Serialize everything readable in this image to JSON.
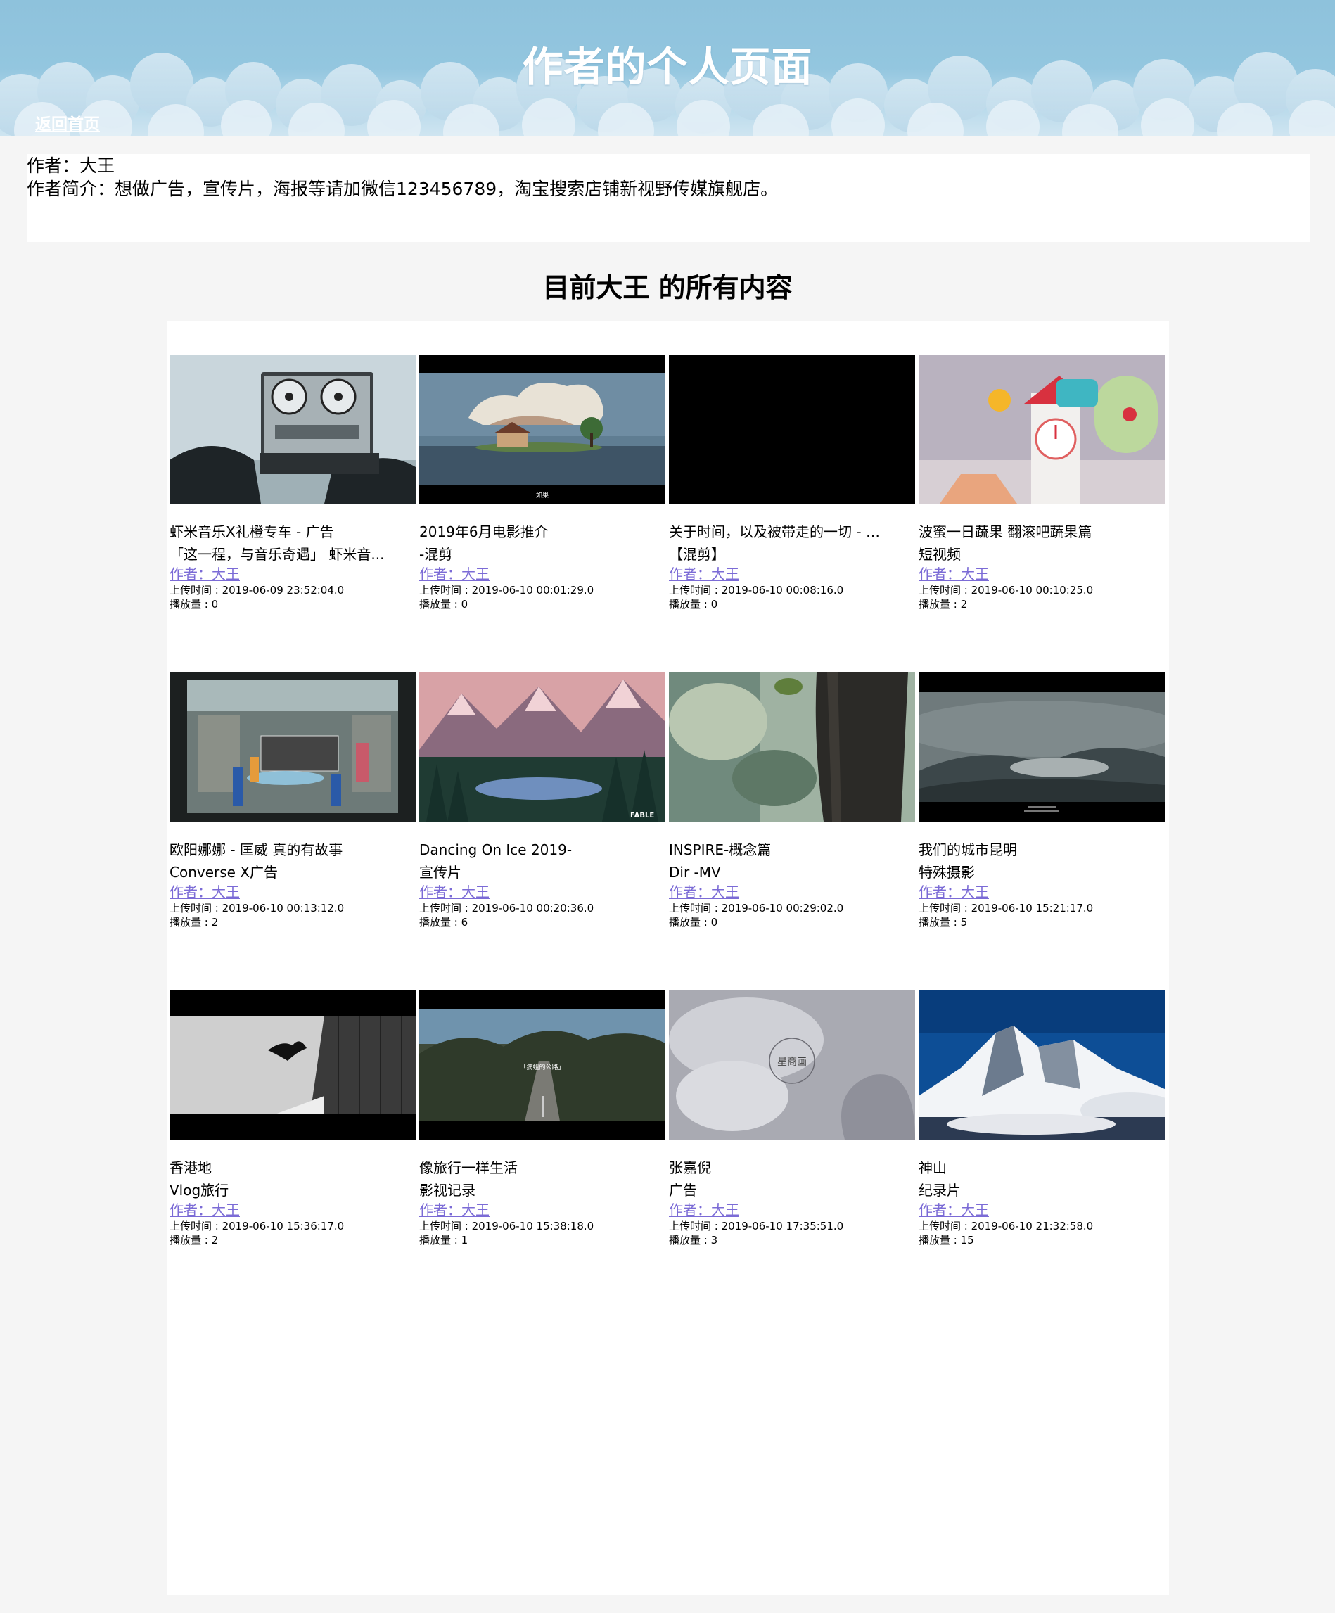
{
  "header": {
    "title": "作者的个人页面",
    "home_link": "返回首页"
  },
  "author": {
    "name_line": "作者：大王",
    "intro_line": "作者简介：想做广告，宣传片，海报等请加微信123456789，淘宝搜索店铺新视野传媒旗舰店。"
  },
  "section_title": "目前大王 的所有内容",
  "videos": [
    {
      "title1": "虾米音乐X礼橙专车 - 广告",
      "title2": "「这一程，与音乐奇遇」 虾米音...",
      "author": "作者：大王",
      "upload": "上传时间 : 2019-06-09 23:52:04.0",
      "plays": "播放量 : 0",
      "thumb": "tape-recorder"
    },
    {
      "title1": "2019年6月电影推介",
      "title2": "-混剪",
      "author": "作者：大王",
      "upload": "上传时间 : 2019-06-10 00:01:29.0",
      "plays": "播放量 : 0",
      "thumb": "anime-house",
      "caption": "如果"
    },
    {
      "title1": "关于时间，以及被带走的一切 - 混剪",
      "title2": "【混剪】",
      "author": "作者：大王",
      "upload": "上传时间 : 2019-06-10 00:08:16.0",
      "plays": "播放量 : 0",
      "thumb": "black-frame"
    },
    {
      "title1": "波蜜一日蔬果 翻滚吧蔬果篇",
      "title2": "短视频",
      "author": "作者：大王",
      "upload": "上传时间 : 2019-06-10 00:10:25.0",
      "plays": "播放量 : 2",
      "thumb": "clock-house"
    },
    {
      "title1": "欧阳娜娜 - 匡威 真的有故事",
      "title2": "Converse X广告",
      "author": "作者：大王",
      "upload": "上传时间 : 2019-06-10 00:13:12.0",
      "plays": "播放量 : 2",
      "thumb": "store-interior"
    },
    {
      "title1": "Dancing On Ice 2019-",
      "title2": "宣传片",
      "author": "作者：大王",
      "upload": "上传时间 : 2019-06-10 00:20:36.0",
      "plays": "播放量 : 6",
      "thumb": "snow-mountains",
      "caption": "FABLE"
    },
    {
      "title1": "INSPIRE-概念篇",
      "title2": "Dir -MV",
      "author": "作者：大王",
      "upload": "上传时间 : 2019-06-10 00:29:02.0",
      "plays": "播放量 : 0",
      "thumb": "tree-trunk"
    },
    {
      "title1": "我们的城市昆明",
      "title2": "特殊摄影",
      "author": "作者：大王",
      "upload": "上传时间 : 2019-06-10 15:21:17.0",
      "plays": "播放量 : 5",
      "thumb": "foggy-hills"
    },
    {
      "title1": "香港地",
      "title2": "Vlog旅行",
      "author": "作者：大王",
      "upload": "上传时间 : 2019-06-10 15:36:17.0",
      "plays": "播放量 : 2",
      "thumb": "pigeon-building"
    },
    {
      "title1": "像旅行一样生活",
      "title2": "影视记录",
      "author": "作者：大王",
      "upload": "上传时间 : 2019-06-10 15:38:18.0",
      "plays": "播放量 : 1",
      "thumb": "forest-road",
      "caption": "「病蛆的公路」"
    },
    {
      "title1": "张嘉倪",
      "title2": "广告",
      "author": "作者：大王",
      "upload": "上传时间 : 2019-06-10 17:35:51.0",
      "plays": "播放量 : 3",
      "thumb": "haze-logo",
      "caption": "星商画"
    },
    {
      "title1": "神山",
      "title2": "纪录片",
      "author": "作者：大王",
      "upload": "上传时间 : 2019-06-10 21:32:58.0",
      "plays": "播放量 : 15",
      "thumb": "everest"
    }
  ],
  "colors": {
    "header_sky": "#8ec2dc",
    "link_purple": "#7b6bd6",
    "page_bg": "#f5f5f5"
  }
}
